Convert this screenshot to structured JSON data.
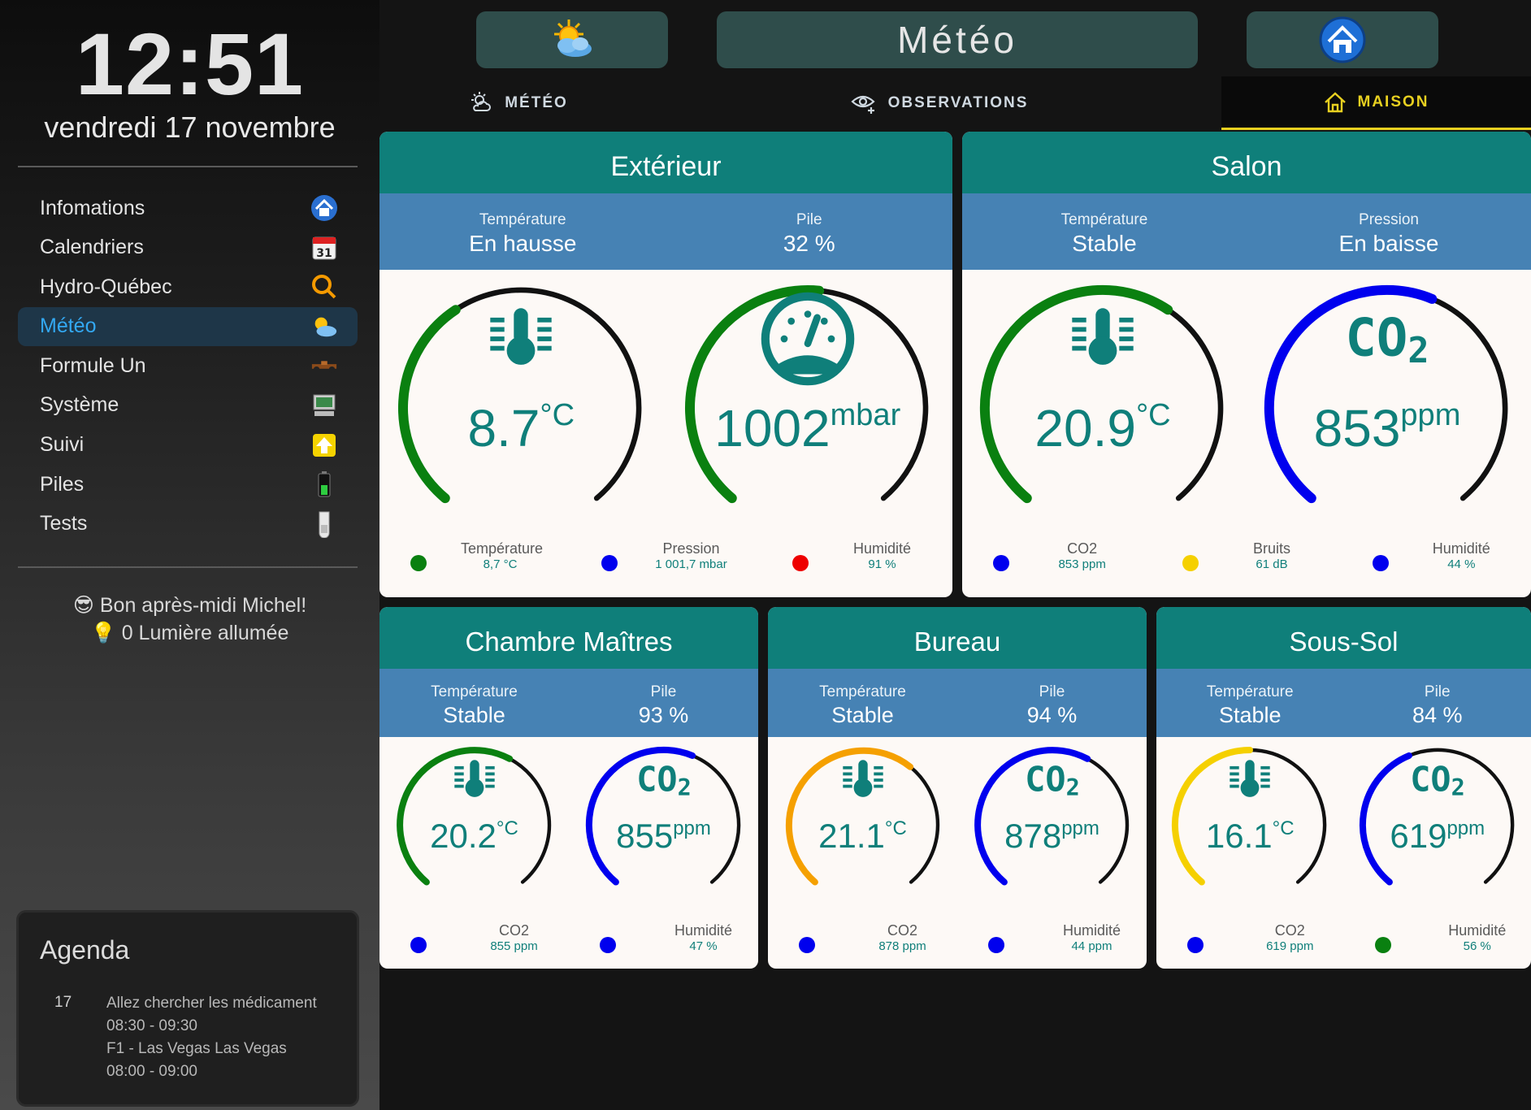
{
  "sidebar": {
    "clock": "12:51",
    "date": "vendredi 17 novembre",
    "items": [
      {
        "label": "Infomations",
        "icon": "house-icon",
        "active": false
      },
      {
        "label": "Calendriers",
        "icon": "calendar-icon",
        "active": false
      },
      {
        "label": "Hydro-Québec",
        "icon": "hydro-logo-icon",
        "active": false
      },
      {
        "label": "Météo",
        "icon": "sun-cloud-icon",
        "active": true
      },
      {
        "label": "Formule Un",
        "icon": "race-car-icon",
        "active": false
      },
      {
        "label": "Système",
        "icon": "computer-icon",
        "active": false
      },
      {
        "label": "Suivi",
        "icon": "up-arrow-icon",
        "active": false
      },
      {
        "label": "Piles",
        "icon": "battery-icon",
        "active": false
      },
      {
        "label": "Tests",
        "icon": "test-tube-icon",
        "active": false
      }
    ],
    "greeting": "Bon après-midi Michel!",
    "greeting_emoji": "😎",
    "lights": "0 Lumière allumée",
    "lights_emoji": "💡",
    "agenda": {
      "title": "Agenda",
      "day": "17",
      "events": [
        {
          "title": "Allez chercher les médicament",
          "time": "08:30 - 09:30"
        },
        {
          "title": "F1 - Las Vegas Las Vegas",
          "time": "08:00 - 09:00"
        }
      ]
    }
  },
  "header": {
    "title": "Météo",
    "tabs": [
      {
        "label": "MÉTÉO",
        "icon": "weather-icon",
        "active": false
      },
      {
        "label": "OBSERVATIONS",
        "icon": "eye-plus-icon",
        "active": false
      },
      {
        "label": "MAISON",
        "icon": "home-outline-icon",
        "active": true
      }
    ]
  },
  "cards": [
    {
      "title": "Extérieur",
      "sub": [
        {
          "label": "Température",
          "value": "En hausse"
        },
        {
          "label": "Pile",
          "value": "32 %"
        }
      ],
      "gauges": [
        {
          "icon": "thermometer-icon",
          "value": "8.7",
          "unit": "°C",
          "fill": 0.38,
          "color": "#0a8010"
        },
        {
          "icon": "pressure-gauge-icon",
          "value": "1002",
          "unit": "mbar",
          "fill": 0.52,
          "color": "#0a8010"
        }
      ],
      "legend": [
        {
          "label": "Température",
          "value": "8,7 °C",
          "color": "#0a8010"
        },
        {
          "label": "Pression",
          "value": "1 001,7 mbar",
          "color": "#0000ee"
        },
        {
          "label": "Humidité",
          "value": "91 %",
          "color": "#ee0000"
        }
      ]
    },
    {
      "title": "Salon",
      "sub": [
        {
          "label": "Température",
          "value": "Stable"
        },
        {
          "label": "Pression",
          "value": "En baisse"
        }
      ],
      "gauges": [
        {
          "icon": "thermometer-icon",
          "value": "20.9",
          "unit": "°C",
          "fill": 0.62,
          "color": "#0a8010"
        },
        {
          "icon": "co2-icon",
          "value": "853",
          "unit": "ppm",
          "fill": 0.58,
          "color": "#0000ee"
        }
      ],
      "legend": [
        {
          "label": "CO2",
          "value": "853 ppm",
          "color": "#0000ee"
        },
        {
          "label": "Bruits",
          "value": "61 dB",
          "color": "#f5d000"
        },
        {
          "label": "Humidité",
          "value": "44 %",
          "color": "#0000ee"
        }
      ]
    },
    {
      "title": "Chambre Maîtres",
      "sub": [
        {
          "label": "Température",
          "value": "Stable"
        },
        {
          "label": "Pile",
          "value": "93 %"
        }
      ],
      "gauges": [
        {
          "icon": "thermometer-icon",
          "value": "20.2",
          "unit": "°C",
          "fill": 0.6,
          "color": "#0a8010"
        },
        {
          "icon": "co2-icon",
          "value": "855",
          "unit": "ppm",
          "fill": 0.58,
          "color": "#0000ee"
        }
      ],
      "legend": [
        {
          "label": "CO2",
          "value": "855 ppm",
          "color": "#0000ee"
        },
        {
          "label": "Humidité",
          "value": "47 %",
          "color": "#0000ee"
        }
      ]
    },
    {
      "title": "Bureau",
      "sub": [
        {
          "label": "Température",
          "value": "Stable"
        },
        {
          "label": "Pile",
          "value": "94 %"
        }
      ],
      "gauges": [
        {
          "icon": "thermometer-icon",
          "value": "21.1",
          "unit": "°C",
          "fill": 0.64,
          "color": "#f5a000"
        },
        {
          "icon": "co2-icon",
          "value": "878",
          "unit": "ppm",
          "fill": 0.6,
          "color": "#0000ee"
        }
      ],
      "legend": [
        {
          "label": "CO2",
          "value": "878 ppm",
          "color": "#0000ee"
        },
        {
          "label": "Humidité",
          "value": "44 ppm",
          "color": "#0000ee"
        }
      ]
    },
    {
      "title": "Sous-Sol",
      "sub": [
        {
          "label": "Température",
          "value": "Stable"
        },
        {
          "label": "Pile",
          "value": "84 %"
        }
      ],
      "gauges": [
        {
          "icon": "thermometer-icon",
          "value": "16.1",
          "unit": "°C",
          "fill": 0.5,
          "color": "#f5d000"
        },
        {
          "icon": "co2-icon",
          "value": "619",
          "unit": "ppm",
          "fill": 0.42,
          "color": "#0000ee"
        }
      ],
      "legend": [
        {
          "label": "CO2",
          "value": "619 ppm",
          "color": "#0000ee"
        },
        {
          "label": "Humidité",
          "value": "56 %",
          "color": "#0a8010"
        }
      ]
    }
  ]
}
